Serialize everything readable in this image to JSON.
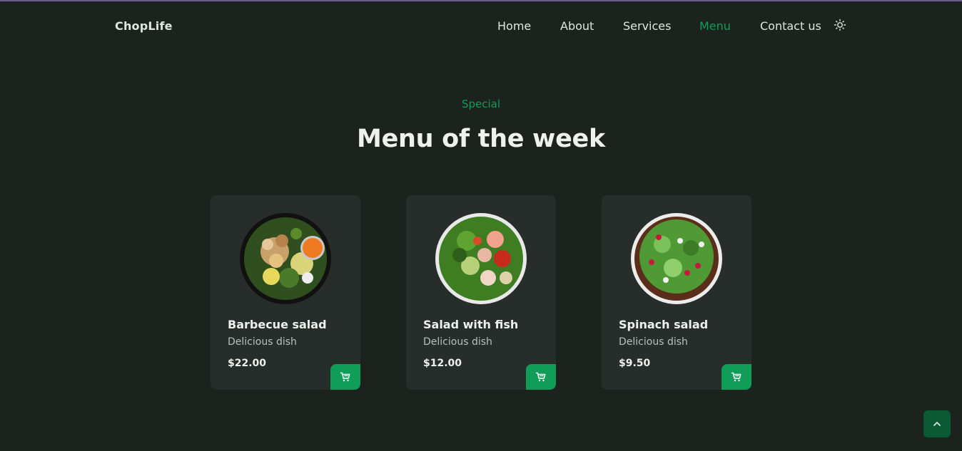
{
  "brand": {
    "logo_text": "ChopLife"
  },
  "nav": {
    "items": [
      {
        "label": "Home"
      },
      {
        "label": "About"
      },
      {
        "label": "Services"
      },
      {
        "label": "Menu",
        "active": true
      },
      {
        "label": "Contact us"
      }
    ],
    "theme_toggle_icon": "sun-icon"
  },
  "section": {
    "subtitle": "Special",
    "title": "Menu of the week"
  },
  "menu": [
    {
      "name": "Barbecue salad",
      "description": "Delicious dish",
      "price": "$22.00",
      "image": "barbecue-salad-bowl"
    },
    {
      "name": "Salad with fish",
      "description": "Delicious dish",
      "price": "$12.00",
      "image": "fish-salad-bowl"
    },
    {
      "name": "Spinach salad",
      "description": "Delicious dish",
      "price": "$9.50",
      "image": "spinach-salad-bowl"
    }
  ],
  "icons": {
    "cart": "cart-icon",
    "scroll_top": "chevron-up-icon"
  },
  "colors": {
    "background": "#1c231f",
    "card": "#262d2a",
    "accent": "#0f9d58",
    "scroll_button": "#0b5a35"
  }
}
